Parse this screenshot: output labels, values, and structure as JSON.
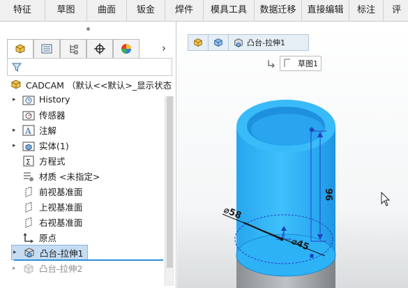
{
  "ribbon": {
    "tabs": [
      "特征",
      "草图",
      "曲面",
      "钣金",
      "焊件",
      "模具工具",
      "数据迁移",
      "直接编辑",
      "标注",
      "评"
    ]
  },
  "tree": {
    "root_label": "CADCAM （默认<<默认>_显示状态",
    "items": [
      {
        "label": "History",
        "icon": "history-folder-icon",
        "expandable": true
      },
      {
        "label": "传感器",
        "icon": "sensor-folder-icon",
        "expandable": false
      },
      {
        "label": "注解",
        "icon": "annotation-icon",
        "expandable": true
      },
      {
        "label": "实体(1)",
        "icon": "solid-body-folder-icon",
        "expandable": true
      },
      {
        "label": "方程式",
        "icon": "equation-icon",
        "expandable": false
      },
      {
        "label": "材质 <未指定>",
        "icon": "material-icon",
        "expandable": false
      },
      {
        "label": "前视基准面",
        "icon": "plane-icon",
        "expandable": false
      },
      {
        "label": "上视基准面",
        "icon": "plane-icon",
        "expandable": false
      },
      {
        "label": "右视基准面",
        "icon": "plane-icon",
        "expandable": false
      },
      {
        "label": "原点",
        "icon": "origin-icon",
        "expandable": false
      },
      {
        "label": "凸台-拉伸1",
        "icon": "boss-extrude-icon",
        "expandable": true,
        "selected": true
      },
      {
        "label": "凸台-拉伸2",
        "icon": "boss-extrude-icon",
        "expandable": true,
        "faded": true
      }
    ]
  },
  "viewport": {
    "breadcrumb_feature": "凸台-拉伸1",
    "breadcrumb_sketch": "草图1",
    "dimensions": {
      "height": "96",
      "outer_diameter": "⌀58",
      "inner_diameter": "⌀45"
    },
    "model_color": "#35b5f3"
  },
  "colors": {
    "accent": "#2c8fd9",
    "selection": "#c5dcf3",
    "dimension": "#1f3fbf"
  }
}
